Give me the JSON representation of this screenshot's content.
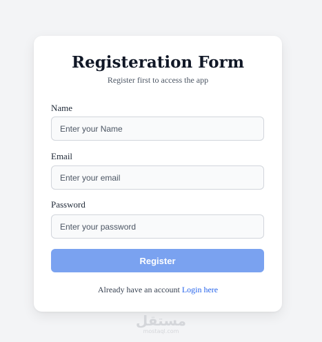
{
  "form": {
    "title": "Registeration Form",
    "subtitle": "Register first to access the app",
    "fields": [
      {
        "label": "Name",
        "placeholder": "Enter your Name",
        "value": ""
      },
      {
        "label": "Email",
        "placeholder": "Enter your email",
        "value": ""
      },
      {
        "label": "Password",
        "placeholder": "Enter your password",
        "value": ""
      }
    ],
    "submit_label": "Register",
    "footer_text": "Already have an account",
    "login_link": "Login here"
  },
  "watermark": {
    "main": "مستقل",
    "sub": "mostaql.com"
  },
  "colors": {
    "background": "#f3f4f6",
    "card": "#ffffff",
    "button": "#7aa2f0",
    "link": "#2563eb"
  }
}
